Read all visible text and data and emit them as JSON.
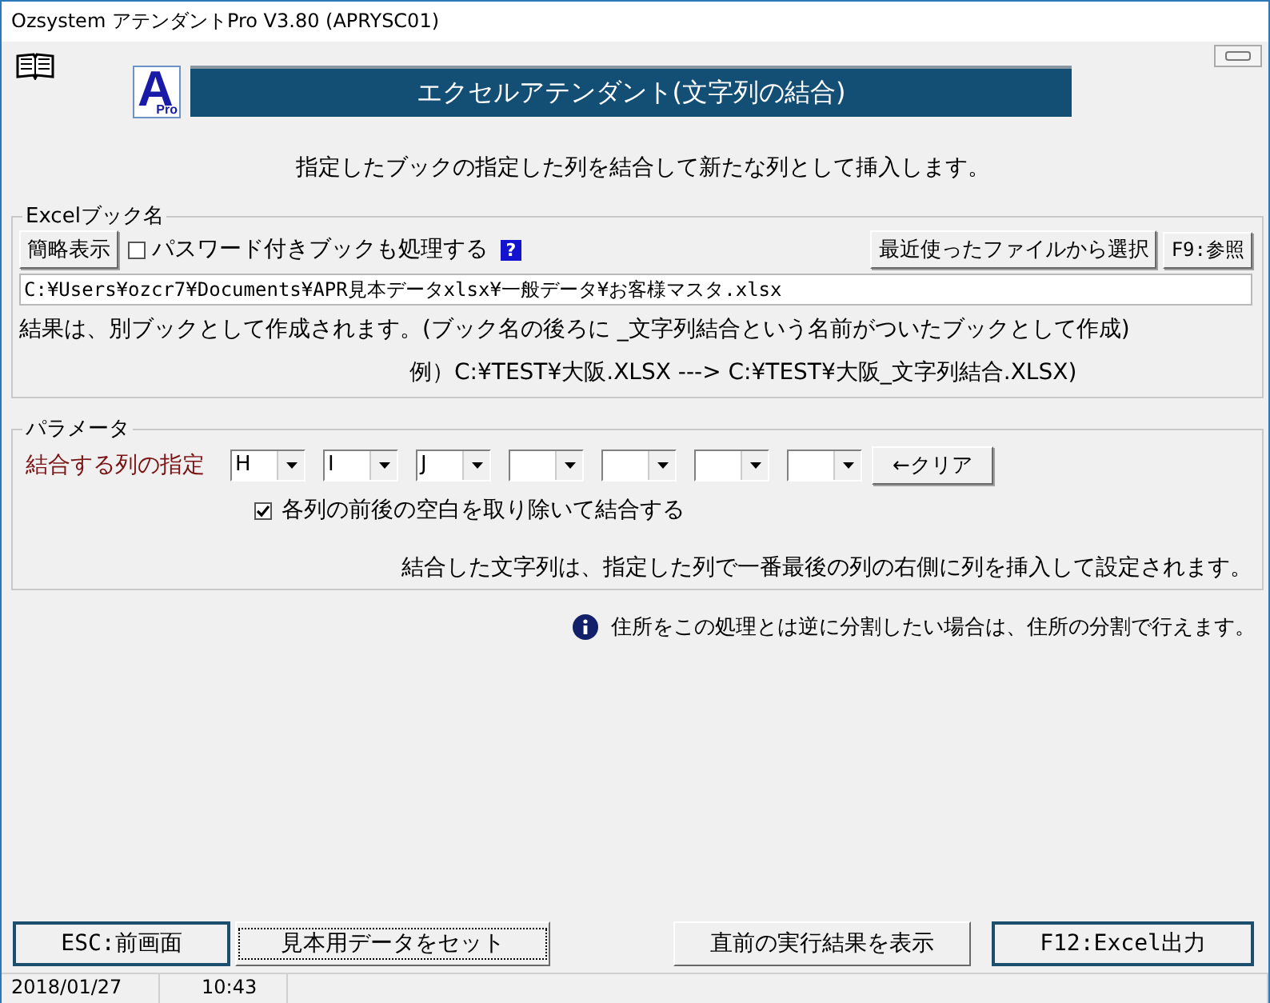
{
  "window": {
    "title": "Ozsystem アテンダントPro V3.80 (APRYSC01)"
  },
  "header": {
    "logo_letter": "A",
    "logo_sub": "Pro",
    "banner": "エクセルアテンダント(文字列の結合)"
  },
  "description": "指定したブックの指定した列を結合して新たな列として挿入します。",
  "book_group": {
    "legend": "Excelブック名",
    "summary_button": "簡略表示",
    "password_checkbox": {
      "label": "パスワード付きブックも処理する",
      "checked": false
    },
    "help_badge": "?",
    "recent_button": "最近使ったファイルから選択",
    "browse_button": "F9:参照",
    "path": "C:¥Users¥ozcr7¥Documents¥APR見本データxlsx¥一般データ¥お客様マスタ.xlsx",
    "note": "結果は、別ブックとして作成されます。(ブック名の後ろに _文字列結合という名前がついたブックとして作成)",
    "example": "例）C:¥TEST¥大阪.XLSX ---> C:¥TEST¥大阪_文字列結合.XLSX)"
  },
  "params": {
    "legend": "パラメータ",
    "columns_label": "結合する列の指定",
    "columns": [
      {
        "value": "H"
      },
      {
        "value": "I"
      },
      {
        "value": "J"
      },
      {},
      {},
      {},
      {}
    ],
    "clear_button": "←クリア",
    "trim_checkbox": {
      "label": "各列の前後の空白を取り除いて結合する",
      "checked": true
    },
    "note": "結合した文字列は、指定した列で一番最後の列の右側に列を挿入して設定されます。"
  },
  "info_note": "住所をこの処理とは逆に分割したい場合は、住所の分割で行えます。",
  "buttons": [
    {
      "label": "ESC:前画面",
      "emphasized": true,
      "focused": false
    },
    {
      "label": "見本用データをセット",
      "emphasized": false,
      "focused": true
    },
    {
      "label": "直前の実行結果を表示",
      "emphasized": false,
      "focused": false
    },
    {
      "label": "F12:Excel出力",
      "emphasized": true,
      "focused": false
    }
  ],
  "status_bar": {
    "date": "2018/01/27",
    "time": "10:43"
  }
}
